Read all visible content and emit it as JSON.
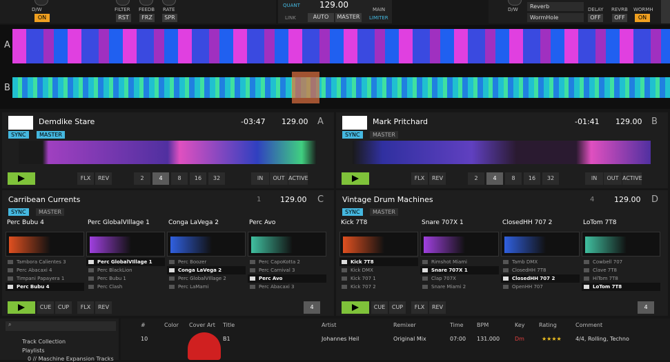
{
  "fx_left": {
    "labels": {
      "dw": "D/W",
      "filter": "FILTER",
      "feedb": "FEEDB",
      "rate": "RATE"
    },
    "buttons": {
      "on": "ON",
      "rst": "RST",
      "frz": "FRZ",
      "spr": "SPR"
    }
  },
  "center": {
    "quant": "QUANT",
    "bpm": "129.00",
    "link": "LINK",
    "auto": "AUTO",
    "master": "MASTER",
    "main": "MAIN",
    "limiter": "LIMITER"
  },
  "fx_right": {
    "dw": "D/W",
    "effect1": "Reverb",
    "effect2": "WormHole",
    "delay": "DELAY",
    "revrb": "REVRB",
    "wormh": "WORMH",
    "off1": "OFF",
    "off2": "OFF",
    "on": "ON"
  },
  "overview": {
    "label_a": "A",
    "label_b": "B"
  },
  "decks": [
    {
      "title": "Demdike Stare",
      "time": "-03:47",
      "bpm": "129.00",
      "letter": "A",
      "sync": "SYNC",
      "master": "MASTER",
      "flx": "FLX",
      "rev": "REV",
      "loops": [
        "2",
        "4",
        "8",
        "16",
        "32"
      ],
      "in": "IN",
      "out": "OUT",
      "active": "ACTIVE"
    },
    {
      "title": "Mark Pritchard",
      "time": "-01:41",
      "bpm": "129.00",
      "letter": "B",
      "sync": "SYNC",
      "master": "MASTER",
      "flx": "FLX",
      "rev": "REV",
      "loops": [
        "2",
        "4",
        "8",
        "16",
        "32"
      ],
      "in": "IN",
      "out": "OUT",
      "active": "ACTIVE"
    },
    {
      "title": "Carribean Currents",
      "pageno": "1",
      "bpm": "129.00",
      "letter": "C",
      "sync": "SYNC",
      "master": "MASTER",
      "cue": "CUE",
      "cup": "CUP",
      "flx": "FLX",
      "rev": "REV",
      "pager": "4",
      "slots": [
        {
          "name": "Perc Bubu 4",
          "items": [
            "Tambora Calientes 3",
            "Perc Abacaxi 4",
            "Timpani Papayera 1",
            "Perc Bubu 4"
          ],
          "active": 3
        },
        {
          "name": "Perc GlobalVIllage 1",
          "items": [
            "Perc GlobalVIllage 1",
            "Perc BlackLion",
            "Perc Bubu 1",
            "Perc Clash"
          ],
          "active": 0
        },
        {
          "name": "Conga LaVega 2",
          "items": [
            "Perc Boozer",
            "Conga LaVega 2",
            "Perc GlobalVIllage 2",
            "Perc LaMami"
          ],
          "active": 1
        },
        {
          "name": "Perc Avo",
          "items": [
            "Perc CapoKotta 2",
            "Perc Carnival 3",
            "Perc Avo",
            "Perc Abacaxi 3"
          ],
          "active": 2
        }
      ]
    },
    {
      "title": "Vintage Drum Machines",
      "pageno": "4",
      "bpm": "129.00",
      "letter": "D",
      "sync": "SYNC",
      "master": "MASTER",
      "cue": "CUE",
      "cup": "CUP",
      "flx": "FLX",
      "rev": "REV",
      "pager": "4",
      "slots": [
        {
          "name": "Kick 7T8",
          "items": [
            "Kick 7T8",
            "Kick DMX",
            "Kick 707 1",
            "Kick 707 2"
          ],
          "active": 0
        },
        {
          "name": "Snare 707X 1",
          "items": [
            "Rimshot Miami",
            "Snare 707X 1",
            "Clap 707X",
            "Snare Miami 2"
          ],
          "active": 1
        },
        {
          "name": "ClosedHH 707 2",
          "items": [
            "Tamb DMX",
            "ClosedHH 7T8",
            "ClosedHH 707 2",
            "OpenHH 707"
          ],
          "active": 2
        },
        {
          "name": "LoTom 7T8",
          "items": [
            "Cowbell 707",
            "Clave 7T8",
            "HiTom 7T8",
            "LoTom 7T8"
          ],
          "active": 3
        }
      ]
    }
  ],
  "browser": {
    "search_placeholder": "",
    "tree": [
      "Track Collection",
      "Playlists",
      "0 // Maschine Expansion Tracks"
    ],
    "columns": [
      "#",
      "Color",
      "Cover Art",
      "Title",
      "Artist",
      "Remixer",
      "Time",
      "BPM",
      "Key",
      "Rating",
      "Comment"
    ],
    "row": {
      "num": "10",
      "title": "B1",
      "artist": "Johannes Heil",
      "remixer": "Original Mix",
      "time": "07:00",
      "bpm": "131.000",
      "key": "Dm",
      "rating": "★★★★",
      "comment": "4/4, Rolling, Techno"
    }
  },
  "colors": {
    "sync": "#45b8e0",
    "play": "#7fc23a",
    "on": "#f0a020"
  }
}
